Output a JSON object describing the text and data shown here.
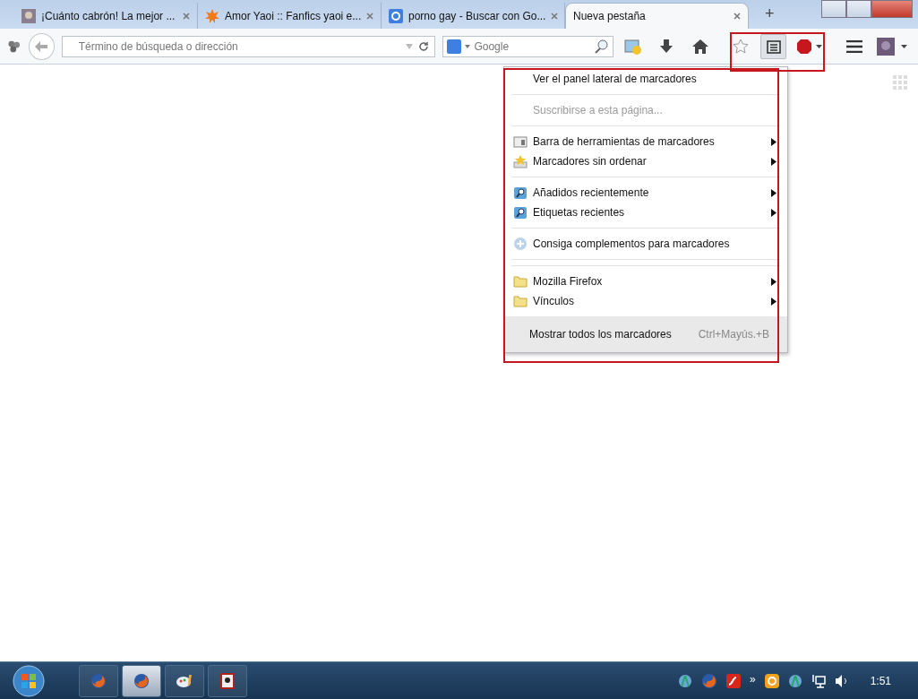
{
  "tabs": [
    {
      "label": "¡Cuánto cabrón! La mejor ...",
      "selected": false
    },
    {
      "label": "Amor Yaoi :: Fanfics yaoi e...",
      "selected": false
    },
    {
      "label": "porno gay - Buscar con Go...",
      "selected": false
    },
    {
      "label": "Nueva pestaña",
      "selected": true
    }
  ],
  "new_tab": "+",
  "url_field": {
    "placeholder": "Término de búsqueda o dirección"
  },
  "search_field": {
    "placeholder": "Google"
  },
  "bookmarks_menu": {
    "items": [
      {
        "kind": "plain",
        "label": "Ver el panel lateral de marcadores",
        "submenu": false,
        "disabled": false
      },
      {
        "kind": "separator"
      },
      {
        "kind": "plain",
        "label": "Suscribirse a esta página...",
        "submenu": false,
        "disabled": true
      },
      {
        "kind": "separator"
      },
      {
        "kind": "toolbar",
        "label": "Barra de herramientas de marcadores",
        "submenu": true,
        "disabled": false
      },
      {
        "kind": "unsorted",
        "label": "Marcadores sin ordenar",
        "submenu": true,
        "disabled": false
      },
      {
        "kind": "separator"
      },
      {
        "kind": "query",
        "label": "Añadidos recientemente",
        "submenu": true,
        "disabled": false
      },
      {
        "kind": "query",
        "label": "Etiquetas recientes",
        "submenu": true,
        "disabled": false
      },
      {
        "kind": "separator"
      },
      {
        "kind": "addon",
        "label": "Consiga complementos para marcadores",
        "submenu": false,
        "disabled": false
      },
      {
        "kind": "separator"
      },
      {
        "kind": "separator"
      },
      {
        "kind": "folder",
        "label": "Mozilla Firefox",
        "submenu": true,
        "disabled": false
      },
      {
        "kind": "folder",
        "label": "Vínculos",
        "submenu": true,
        "disabled": false
      }
    ],
    "footer": {
      "label": "Mostrar todos los marcadores",
      "shortcut": "Ctrl+Mayús.+B"
    }
  },
  "taskbar": {
    "apps": [
      {
        "kind": "firefox",
        "selected": false
      },
      {
        "kind": "firefox",
        "selected": true
      },
      {
        "kind": "paint",
        "selected": false
      },
      {
        "kind": "app",
        "selected": false
      }
    ],
    "tray_expand": "»",
    "clock": "1:51"
  }
}
